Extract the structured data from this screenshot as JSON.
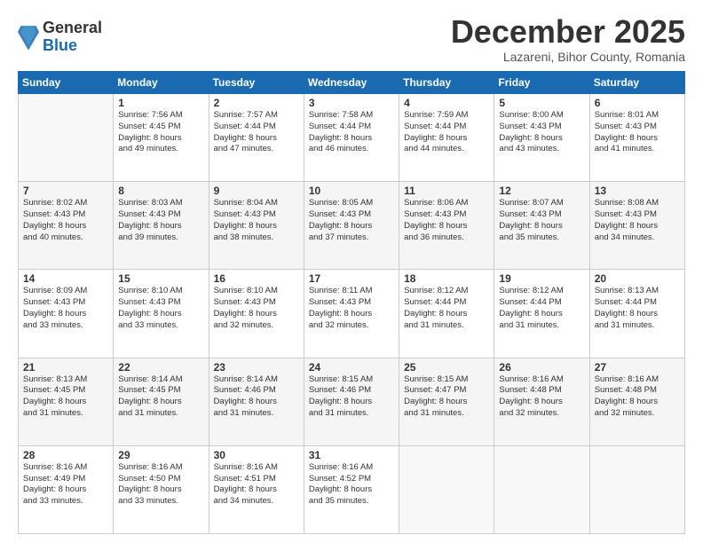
{
  "header": {
    "logo_general": "General",
    "logo_blue": "Blue",
    "title": "December 2025",
    "subtitle": "Lazareni, Bihor County, Romania"
  },
  "days_of_week": [
    "Sunday",
    "Monday",
    "Tuesday",
    "Wednesday",
    "Thursday",
    "Friday",
    "Saturday"
  ],
  "weeks": [
    [
      {
        "day": "",
        "info": ""
      },
      {
        "day": "1",
        "info": "Sunrise: 7:56 AM\nSunset: 4:45 PM\nDaylight: 8 hours\nand 49 minutes."
      },
      {
        "day": "2",
        "info": "Sunrise: 7:57 AM\nSunset: 4:44 PM\nDaylight: 8 hours\nand 47 minutes."
      },
      {
        "day": "3",
        "info": "Sunrise: 7:58 AM\nSunset: 4:44 PM\nDaylight: 8 hours\nand 46 minutes."
      },
      {
        "day": "4",
        "info": "Sunrise: 7:59 AM\nSunset: 4:44 PM\nDaylight: 8 hours\nand 44 minutes."
      },
      {
        "day": "5",
        "info": "Sunrise: 8:00 AM\nSunset: 4:43 PM\nDaylight: 8 hours\nand 43 minutes."
      },
      {
        "day": "6",
        "info": "Sunrise: 8:01 AM\nSunset: 4:43 PM\nDaylight: 8 hours\nand 41 minutes."
      }
    ],
    [
      {
        "day": "7",
        "info": "Sunrise: 8:02 AM\nSunset: 4:43 PM\nDaylight: 8 hours\nand 40 minutes."
      },
      {
        "day": "8",
        "info": "Sunrise: 8:03 AM\nSunset: 4:43 PM\nDaylight: 8 hours\nand 39 minutes."
      },
      {
        "day": "9",
        "info": "Sunrise: 8:04 AM\nSunset: 4:43 PM\nDaylight: 8 hours\nand 38 minutes."
      },
      {
        "day": "10",
        "info": "Sunrise: 8:05 AM\nSunset: 4:43 PM\nDaylight: 8 hours\nand 37 minutes."
      },
      {
        "day": "11",
        "info": "Sunrise: 8:06 AM\nSunset: 4:43 PM\nDaylight: 8 hours\nand 36 minutes."
      },
      {
        "day": "12",
        "info": "Sunrise: 8:07 AM\nSunset: 4:43 PM\nDaylight: 8 hours\nand 35 minutes."
      },
      {
        "day": "13",
        "info": "Sunrise: 8:08 AM\nSunset: 4:43 PM\nDaylight: 8 hours\nand 34 minutes."
      }
    ],
    [
      {
        "day": "14",
        "info": "Sunrise: 8:09 AM\nSunset: 4:43 PM\nDaylight: 8 hours\nand 33 minutes."
      },
      {
        "day": "15",
        "info": "Sunrise: 8:10 AM\nSunset: 4:43 PM\nDaylight: 8 hours\nand 33 minutes."
      },
      {
        "day": "16",
        "info": "Sunrise: 8:10 AM\nSunset: 4:43 PM\nDaylight: 8 hours\nand 32 minutes."
      },
      {
        "day": "17",
        "info": "Sunrise: 8:11 AM\nSunset: 4:43 PM\nDaylight: 8 hours\nand 32 minutes."
      },
      {
        "day": "18",
        "info": "Sunrise: 8:12 AM\nSunset: 4:44 PM\nDaylight: 8 hours\nand 31 minutes."
      },
      {
        "day": "19",
        "info": "Sunrise: 8:12 AM\nSunset: 4:44 PM\nDaylight: 8 hours\nand 31 minutes."
      },
      {
        "day": "20",
        "info": "Sunrise: 8:13 AM\nSunset: 4:44 PM\nDaylight: 8 hours\nand 31 minutes."
      }
    ],
    [
      {
        "day": "21",
        "info": "Sunrise: 8:13 AM\nSunset: 4:45 PM\nDaylight: 8 hours\nand 31 minutes."
      },
      {
        "day": "22",
        "info": "Sunrise: 8:14 AM\nSunset: 4:45 PM\nDaylight: 8 hours\nand 31 minutes."
      },
      {
        "day": "23",
        "info": "Sunrise: 8:14 AM\nSunset: 4:46 PM\nDaylight: 8 hours\nand 31 minutes."
      },
      {
        "day": "24",
        "info": "Sunrise: 8:15 AM\nSunset: 4:46 PM\nDaylight: 8 hours\nand 31 minutes."
      },
      {
        "day": "25",
        "info": "Sunrise: 8:15 AM\nSunset: 4:47 PM\nDaylight: 8 hours\nand 31 minutes."
      },
      {
        "day": "26",
        "info": "Sunrise: 8:16 AM\nSunset: 4:48 PM\nDaylight: 8 hours\nand 32 minutes."
      },
      {
        "day": "27",
        "info": "Sunrise: 8:16 AM\nSunset: 4:48 PM\nDaylight: 8 hours\nand 32 minutes."
      }
    ],
    [
      {
        "day": "28",
        "info": "Sunrise: 8:16 AM\nSunset: 4:49 PM\nDaylight: 8 hours\nand 33 minutes."
      },
      {
        "day": "29",
        "info": "Sunrise: 8:16 AM\nSunset: 4:50 PM\nDaylight: 8 hours\nand 33 minutes."
      },
      {
        "day": "30",
        "info": "Sunrise: 8:16 AM\nSunset: 4:51 PM\nDaylight: 8 hours\nand 34 minutes."
      },
      {
        "day": "31",
        "info": "Sunrise: 8:16 AM\nSunset: 4:52 PM\nDaylight: 8 hours\nand 35 minutes."
      },
      {
        "day": "",
        "info": ""
      },
      {
        "day": "",
        "info": ""
      },
      {
        "day": "",
        "info": ""
      }
    ]
  ]
}
